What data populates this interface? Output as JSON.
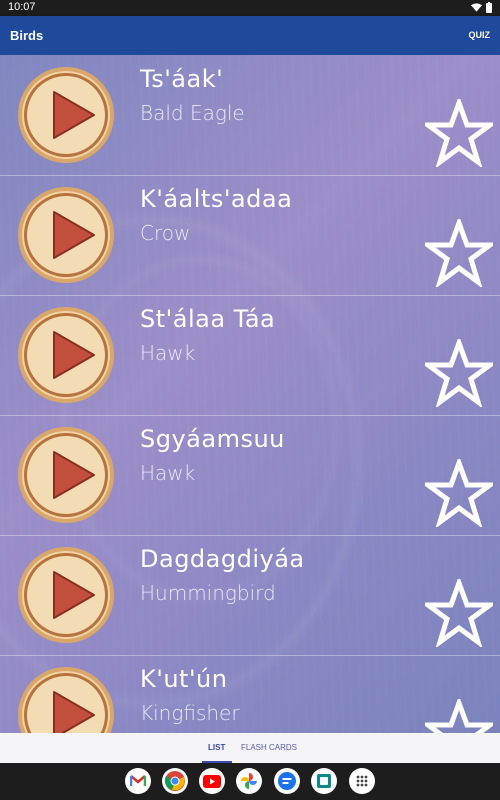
{
  "status": {
    "time": "10:07"
  },
  "app_bar": {
    "title": "Birds",
    "quiz_label": "QUIZ"
  },
  "birds": [
    {
      "word": "Ts'áak'",
      "meaning": "Bald Eagle"
    },
    {
      "word": "K'áalts'adaa",
      "meaning": "Crow"
    },
    {
      "word": "St'álaa Táa",
      "meaning": "Hawk"
    },
    {
      "word": "Sgyáamsuu",
      "meaning": "Hawk"
    },
    {
      "word": "Dagdagdiyáa",
      "meaning": "Hummingbird"
    },
    {
      "word": "K'ut'ún",
      "meaning": "Kingfisher"
    }
  ],
  "tabs": {
    "list_label": "LIST",
    "flash_cards_label": "FLASH CARDS"
  },
  "colors": {
    "app_bar": "#1f4a9c",
    "background": "#8a88c4",
    "play_ring": "#c98a4c",
    "play_triangle": "#c2503c",
    "tab_active": "#3a49b0"
  },
  "dock": [
    "gmail-icon",
    "chrome-icon",
    "youtube-icon",
    "photos-icon",
    "messages-icon",
    "app-icon",
    "app-drawer-icon"
  ]
}
